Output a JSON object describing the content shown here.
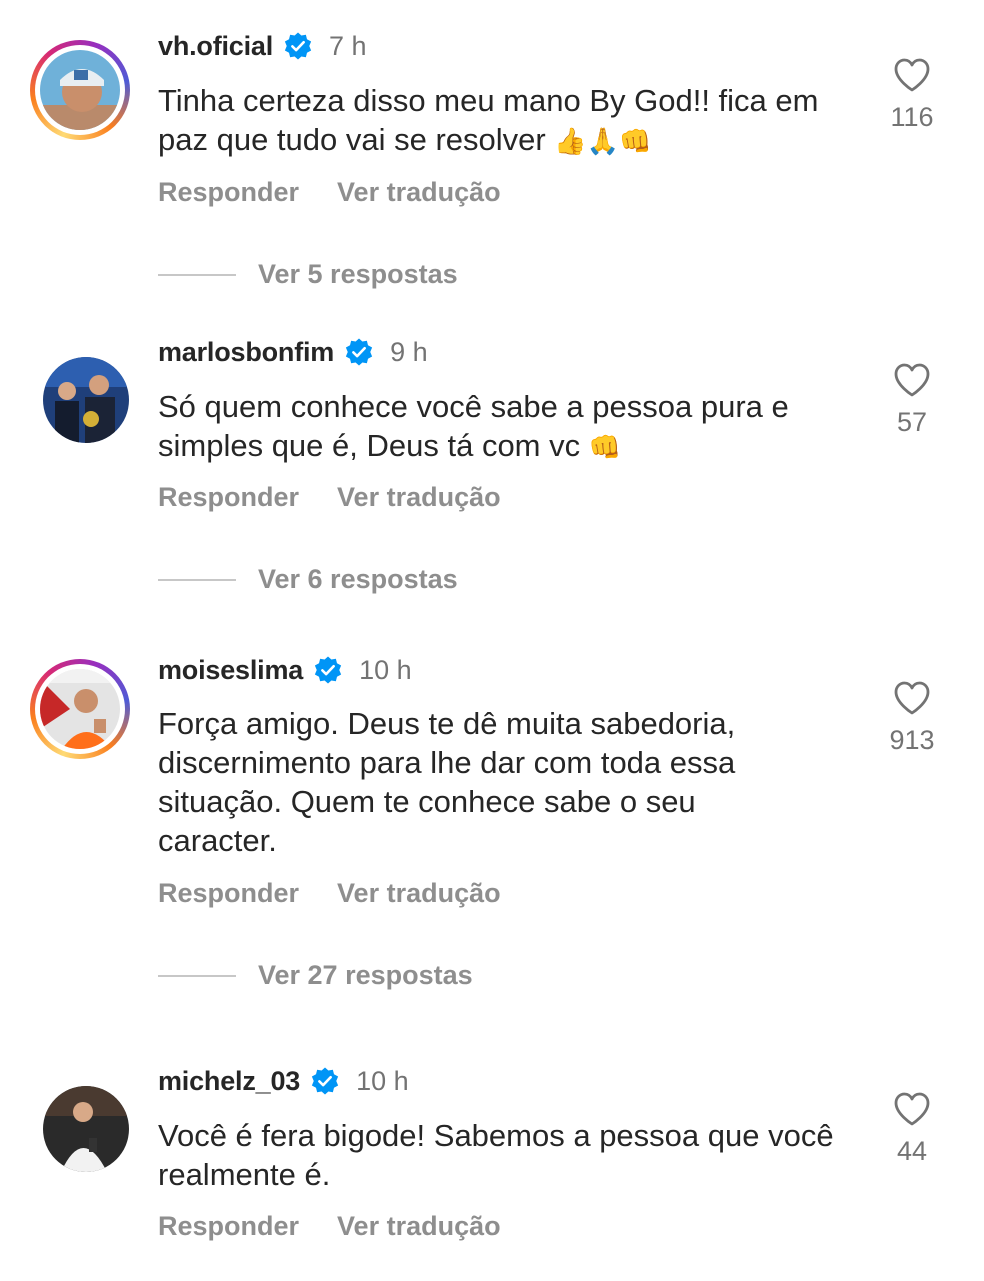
{
  "comments": [
    {
      "username": "vh.oficial",
      "time": "7 h",
      "text": "Tinha certeza disso meu mano By God!! fica em paz que tudo vai se resolver",
      "emojis": "👍🙏👊",
      "likes": "116",
      "reply_label": "Responder",
      "translate_label": "Ver tradução",
      "view_replies": "Ver 5 respostas"
    },
    {
      "username": "marlosbonfim",
      "time": "9 h",
      "text": "Só quem conhece você sabe a pessoa pura e simples que é, Deus tá com vc",
      "emojis": "👊",
      "likes": "57",
      "reply_label": "Responder",
      "translate_label": "Ver tradução",
      "view_replies": "Ver 6 respostas"
    },
    {
      "username": "moiseslima",
      "time": "10 h",
      "text": "Força amigo. Deus te dê muita sabedoria, discernimento para lhe dar com toda essa situação. Quem te conhece sabe o seu caracter.",
      "emojis": "",
      "likes": "913",
      "reply_label": "Responder",
      "translate_label": "Ver tradução",
      "view_replies": "Ver 27 respostas"
    },
    {
      "username": "michelz_03",
      "time": "10 h",
      "text": "Você é fera bigode! Sabemos a pessoa que você realmente é.",
      "emojis": "",
      "likes": "44",
      "reply_label": "Responder",
      "translate_label": "Ver tradução"
    }
  ],
  "colors": {
    "verified_blue": "#0095f6",
    "secondary_text": "#8e8e8e",
    "primary_text": "#262626"
  },
  "icons": [
    "verified-badge-icon",
    "heart-outline-icon"
  ]
}
